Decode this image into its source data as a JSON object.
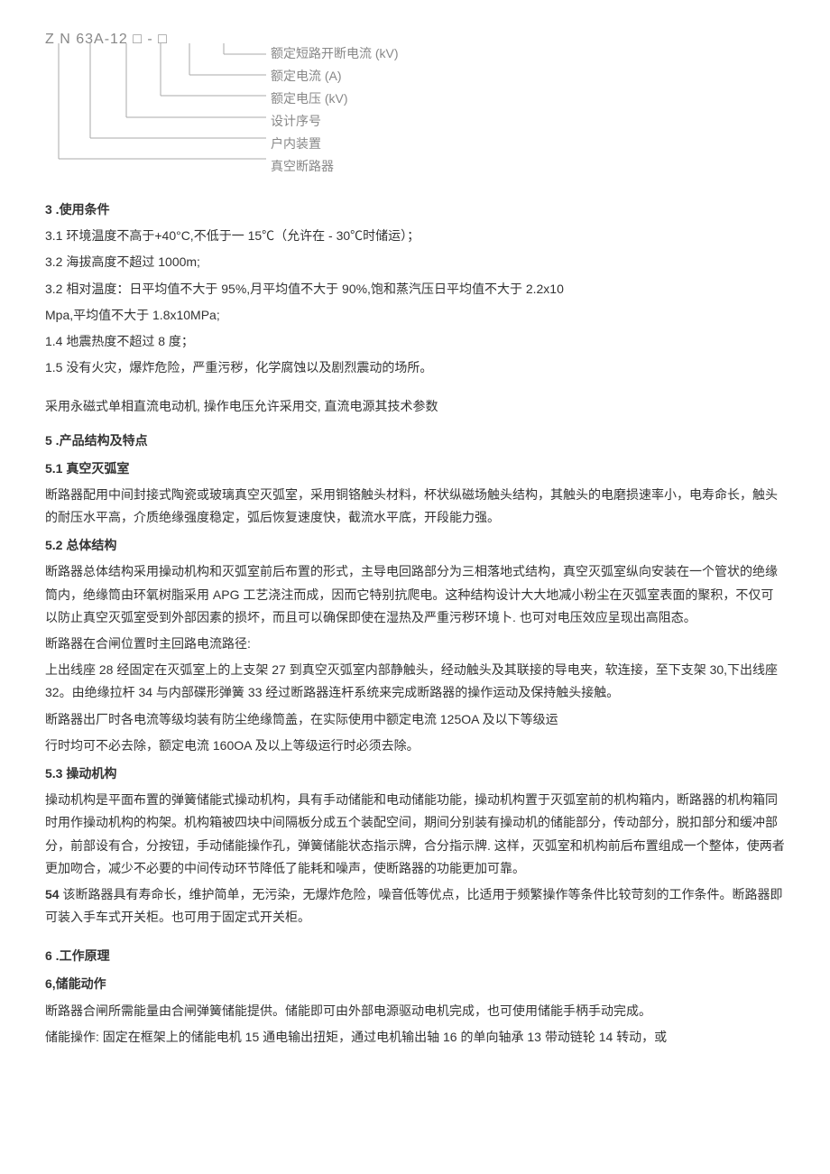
{
  "diagram": {
    "code": "Z N  63A-12 □ - □",
    "labels": [
      "额定短路开断电流 (kV)",
      "额定电流 (A)",
      "额定电压 (kV)",
      "设计序号",
      "户内装置",
      "真空断路器"
    ]
  },
  "s3": {
    "title": "3  .使用条件",
    "l1": "3.1   环境温度不高于+40°C,不低于一 15℃（允许在 - 30℃时储运）；",
    "l2": "3.2   海拔高度不超过 1000m;",
    "l3": "3.2 相对温度：日平均值不大于 95%,月平均值不大于 90%,饱和蒸汽压日平均值不大于 2.2x10",
    "l4": "Mpa,平均值不大于 1.8x10MPa;",
    "l5": "1.4   地震热度不超过 8 度；",
    "l6": "1.5   没有火灾，爆炸危险，严重污秽，化学腐蚀以及剧烈震动的场所。"
  },
  "motor": "采用永磁式单相直流电动机, 操作电压允许采用交, 直流电源其技术参数",
  "s5": {
    "title": "5  .产品结构及特点",
    "s51_title": "5.1   真空灭弧室",
    "s51_body": "断路器配用中间封接式陶瓷或玻璃真空灭弧室，采用铜铬触头材料，杯状纵磁场触头结构，其触头的电磨损速率小，电寿命长，触头的耐压水平高，介质绝缘强度稳定，弧后恢复速度快，截流水平底，开段能力强。",
    "s52_title": "5.2   总体结构",
    "s52_p1": "断路器总体结构采用操动机构和灭弧室前后布置的形式，主导电回路部分为三相落地式结构，真空灭弧室纵向安装在一个管状的绝缘筒内，绝缘筒由环氧树脂采用 APG 工艺浇注而成，因而它特别抗爬电。这种结构设计大大地减小粉尘在灭弧室表面的聚积，不仅可以防止真空灭弧室受到外部因素的损坏，而且可以确保即使在湿热及严重污秽环境卜. 也可对电压效应呈现出高阻态。",
    "s52_p2": "断路器在合闸位置时主回路电流路径:",
    "s52_p3": "上出线座 28 经固定在灭弧室上的上支架 27 到真空灭弧室内部静触头，经动触头及其联接的导电夹，软连接，至下支架 30,下出线座 32。由绝缘拉杆 34 与内部碟形弹簧 33 经过断路器连杆系统来完成断路器的操作运动及保持触头接触。",
    "s52_p4": "断路器出厂时各电流等级均装有防尘绝缘筒盖，在实际使用中额定电流 125OA 及以下等级运",
    "s52_p5": "行时均可不必去除，额定电流 160OA 及以上等级运行时必须去除。",
    "s53_title": "5.3   操动机构",
    "s53_p1": "操动机构是平面布置的弹簧储能式操动机构，具有手动储能和电动储能功能，操动机构置于灭弧室前的机构箱内，断路器的机构箱同时用作操动机构的构架。机构箱被四块中间隔板分成五个装配空间，期间分别装有操动机的储能部分，传动部分，脱扣部分和缓冲部分，前部设有合，分按钮，手动储能操作孔，弹簧储能状态指示牌，合分指示牌. 这样，灭弧室和机构前后布置组成一个整体，使两者更加吻合，减少不必要的中间传动环节降低了能耗和噪声，使断路器的功能更加可靠。",
    "s53_p2_prefix": "54 ",
    "s53_p2": "该断路器具有寿命长，维护简单，无污染，无爆炸危险，噪音低等优点，比适用于频繁操作等条件比较苛刻的工作条件。断路器即可装入手车式开关柜。也可用于固定式开关柜。"
  },
  "s6": {
    "title": "6  .工作原理",
    "sub": "6,储能动作",
    "p1": "断路器合闸所需能量由合闸弹簧储能提供。储能即可由外部电源驱动电机完成，也可使用储能手柄手动完成。",
    "p2": "储能操作: 固定在框架上的储能电机 15 通电输出扭矩，通过电机输出轴 16 的单向轴承 13 带动链轮 14 转动，或"
  }
}
